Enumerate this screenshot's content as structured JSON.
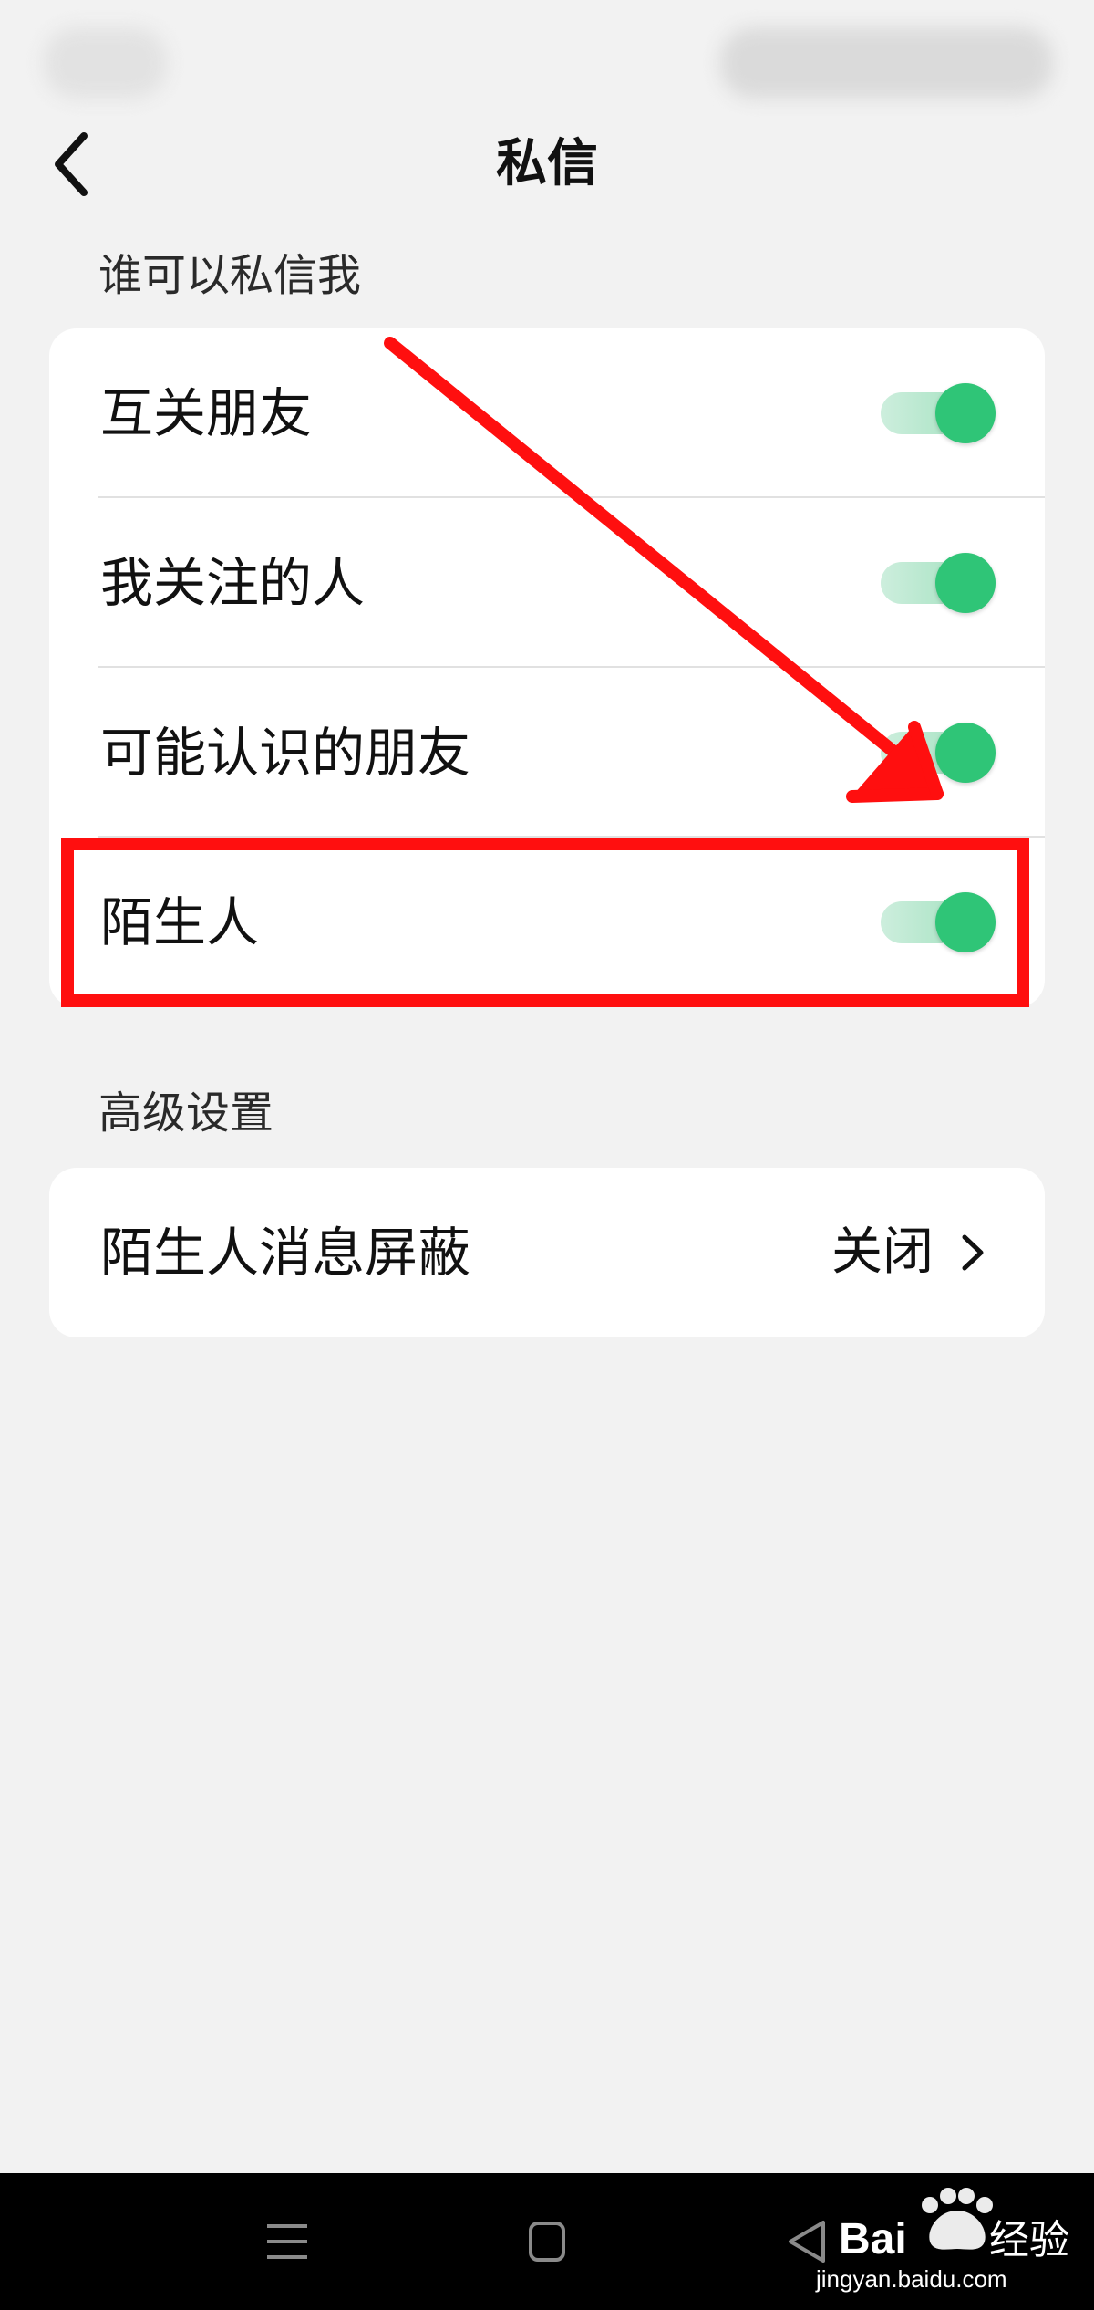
{
  "header": {
    "title": "私信"
  },
  "sections": {
    "who_can_message": {
      "title": "谁可以私信我",
      "items": [
        {
          "label": "互关朋友",
          "enabled": true
        },
        {
          "label": "我关注的人",
          "enabled": true
        },
        {
          "label": "可能认识的朋友",
          "enabled": true
        },
        {
          "label": "陌生人",
          "enabled": true
        }
      ]
    },
    "advanced": {
      "title": "高级设置",
      "items": [
        {
          "label": "陌生人消息屏蔽",
          "value": "关闭"
        }
      ]
    }
  },
  "colors": {
    "toggle_on": "#2fc577",
    "annotation": "#ff0f0f",
    "background": "#f2f2f2"
  },
  "icons": {
    "back": "chevron-left-icon",
    "nav": [
      "menu-icon",
      "home-icon",
      "back-triangle-icon"
    ]
  },
  "watermark": {
    "brand": "Bai du 经验",
    "url": "jingyan.baidu.com"
  }
}
